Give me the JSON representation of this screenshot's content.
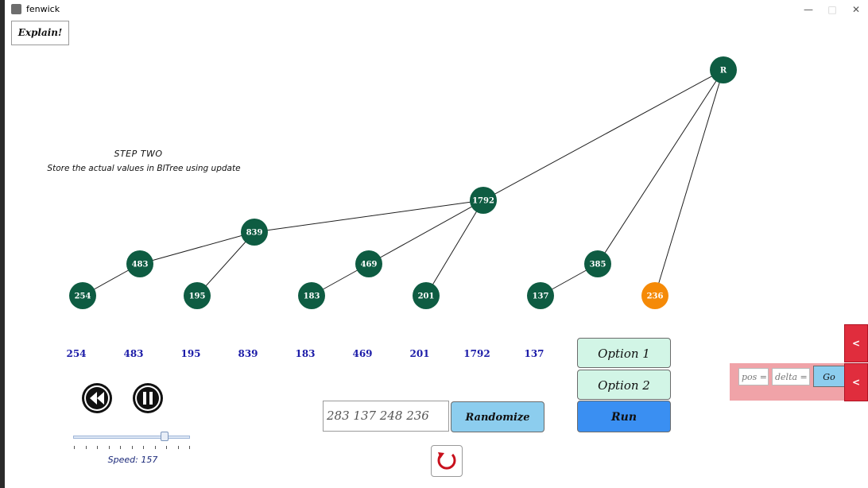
{
  "window": {
    "title": "fenwick",
    "minimize_glyph": "—",
    "maximize_glyph": "□",
    "close_glyph": "✕"
  },
  "explain_button": "Explain!",
  "step": {
    "title": "STEP TWO",
    "description": "Store the actual values in BITree using update"
  },
  "tree": {
    "root_label": "R",
    "nodes": [
      "254",
      "483",
      "195",
      "839",
      "183",
      "469",
      "201",
      "1792",
      "137",
      "385",
      "236"
    ],
    "highlighted_node": "236",
    "node_color": "#0e5c42",
    "highlight_color": "#f58a07"
  },
  "array_values": [
    "254",
    "483",
    "195",
    "839",
    "183",
    "469",
    "201",
    "1792",
    "137"
  ],
  "controls": {
    "option1_label": "Option 1",
    "option2_label": "Option 2",
    "run_label": "Run",
    "array_input_value": "283 137 248 236",
    "randomize_label": "Randomize",
    "speed_label": "Speed: 157",
    "speed_value": 157
  },
  "update_panel": {
    "pos_placeholder": "pos =",
    "delta_placeholder": "delta =",
    "go_label": "Go",
    "tab_arrow": "<"
  },
  "colors": {
    "option_bg": "#d2f5e6",
    "run_bg": "#3a8ff2",
    "randomize_bg": "#8ccdee",
    "panel_bg": "#f0a3a8",
    "tab_bg": "#e02d3d",
    "array_text": "#1c1ca8"
  }
}
